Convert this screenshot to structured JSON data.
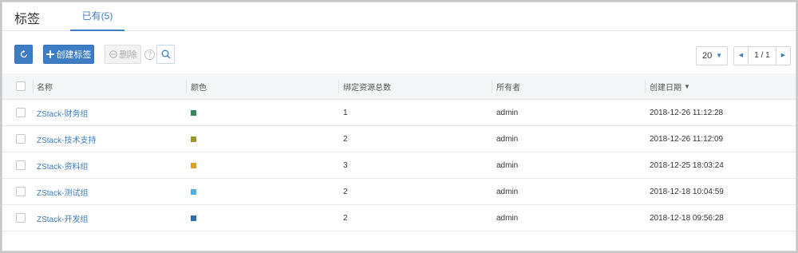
{
  "header": {
    "title": "标签",
    "tab_label": "已有(5)"
  },
  "toolbar": {
    "create_label": "创建标签",
    "delete_label": "删除",
    "help_glyph": "?"
  },
  "pagination": {
    "page_size": "20",
    "page_indicator": "1 / 1"
  },
  "table": {
    "columns": [
      "名称",
      "颜色",
      "绑定资源总数",
      "所有者",
      "创建日期"
    ],
    "rows": [
      {
        "name": "ZStack-财务组",
        "color": "#2e8b57",
        "count": "1",
        "owner": "admin",
        "date": "2018-12-26 11:12:28"
      },
      {
        "name": "ZStack-技术支持",
        "color": "#9a9a2a",
        "count": "2",
        "owner": "admin",
        "date": "2018-12-26 11:12:09"
      },
      {
        "name": "ZStack-资料组",
        "color": "#e0a020",
        "count": "3",
        "owner": "admin",
        "date": "2018-12-25 18:03:24"
      },
      {
        "name": "ZStack-测试组",
        "color": "#4ab0e8",
        "count": "2",
        "owner": "admin",
        "date": "2018-12-18 10:04:59"
      },
      {
        "name": "ZStack-开发组",
        "color": "#2f6db5",
        "count": "2",
        "owner": "admin",
        "date": "2018-12-18 09:56:28"
      }
    ]
  },
  "icons": [
    "refresh-icon",
    "plus-icon",
    "minus-circle-icon",
    "help-icon",
    "search-icon",
    "chevron-down-icon",
    "chevron-left-icon",
    "chevron-right-icon"
  ],
  "colors": {
    "accent": "#3c7dc4",
    "header_bg": "#f4f6f8"
  }
}
